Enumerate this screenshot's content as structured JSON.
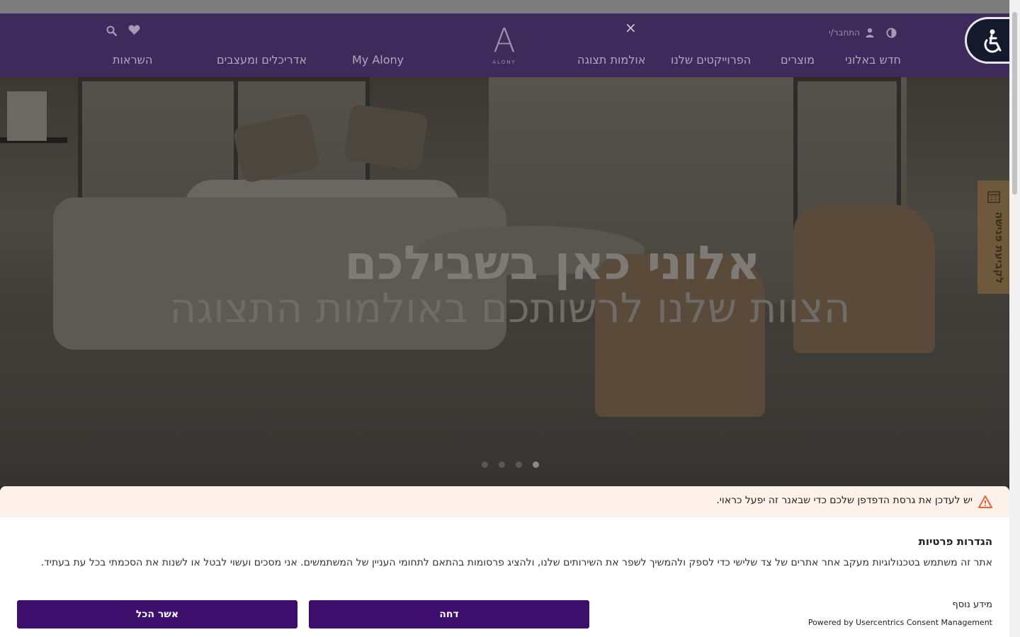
{
  "header": {
    "login_label": "התחבר/י",
    "close_symbol": "×",
    "logo_mark": "A",
    "logo_word": "ALONY"
  },
  "nav": {
    "items": [
      {
        "label": "חדש באלוני"
      },
      {
        "label": "מוצרים"
      },
      {
        "label": "הפרוייקטים שלנו"
      },
      {
        "label": "אולמות תצוגה"
      },
      {
        "label": "My Alony"
      },
      {
        "label": "אדריכלים ומעצבים"
      },
      {
        "label": "השראות"
      }
    ]
  },
  "hero": {
    "title": "אלוני כאן בשבילכם",
    "subtitle": "הצוות שלנו לרשותכם באולמות התצוגה",
    "slide_count": 4,
    "active_slide": 4
  },
  "side_tab": {
    "label": "לקביעת פגישה"
  },
  "consent": {
    "warning": "יש לעדכן את גרסת הדפדפן שלכם כדי שבאנר זה יפעל כראוי.",
    "title": "הגדרות פרטיות",
    "body": "אתר זה משתמש בטכנולוגיות מעקב אחר אתרים של צד שלישי כדי לספק ולהמשיך לשפר את השירותים שלנו, ולהציג פרסומות בהתאם לתחומי העניין של המשתמשים. אני מסכים ועשוי לבטל או לשנות את הסכמתי בכל עת בעתיד.",
    "more_info": "מידע נוסף",
    "powered_by": "Powered by Usercentrics Consent Management",
    "deny_label": "דחה",
    "accept_label": "אשר הכל"
  },
  "colors": {
    "header_bg": "#3f2b5b",
    "button_bg": "#3b0f6b",
    "warning_bg": "#fdf1ea",
    "warning_icon": "#e8623a"
  },
  "icons": [
    "contrast-icon",
    "user-icon",
    "close-icon",
    "heart-icon",
    "search-icon",
    "accessibility-icon",
    "calendar-icon",
    "warning-icon"
  ]
}
